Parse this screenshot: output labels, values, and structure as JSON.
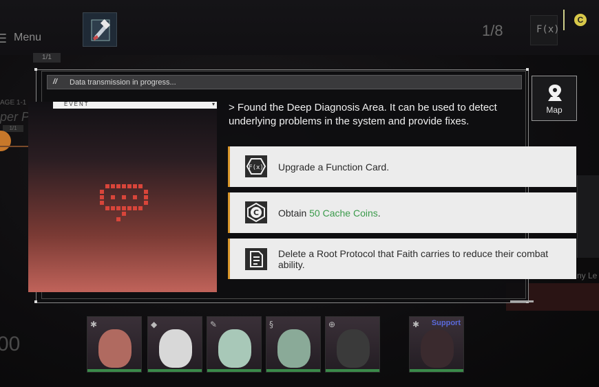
{
  "hud": {
    "menu_label": "Menu",
    "menu_page": "1/1",
    "counter": "1/8",
    "fx_label": "F(x)",
    "coin_symbol": "C",
    "stage_text": "AGE 1-1",
    "stage_name": "per P",
    "stage_badge": "1/1",
    "left_number": "00",
    "right_text": "ny Le"
  },
  "party": [
    {
      "class_icon": "asterisk-icon",
      "hair": "#b06a60"
    },
    {
      "class_icon": "shield-icon",
      "hair": "#d8d8d8"
    },
    {
      "class_icon": "wrench-icon",
      "hair": "#a8c8b8"
    },
    {
      "class_icon": "s-icon",
      "hair": "#8aaa98"
    },
    {
      "class_icon": "crosshair-icon",
      "hair": "#3a3a3a"
    },
    {
      "class_icon": "asterisk-icon",
      "hair": "#3a2a2e",
      "support_label": "Support"
    }
  ],
  "dialog": {
    "transmission": "Data transmission in progress...",
    "event_label": "EVENT",
    "description": "> Found the Deep Diagnosis Area. It can be used to detect underlying problems in the system and provide fixes.",
    "options": [
      {
        "icon": "function-card-icon",
        "icon_text": "F(x)",
        "text": "Upgrade a Function Card."
      },
      {
        "icon": "cache-coin-icon",
        "icon_text": "C",
        "text_before": "Obtain ",
        "highlight": "50 Cache Coins",
        "text_after": "."
      },
      {
        "icon": "document-icon",
        "text": "Delete a Root Protocol that Faith carries to reduce their combat ability."
      }
    ]
  },
  "map": {
    "label": "Map"
  },
  "colors": {
    "accent_orange": "#d8962a",
    "highlight_green": "#3a9a4a",
    "event_red": "#c0635a"
  }
}
